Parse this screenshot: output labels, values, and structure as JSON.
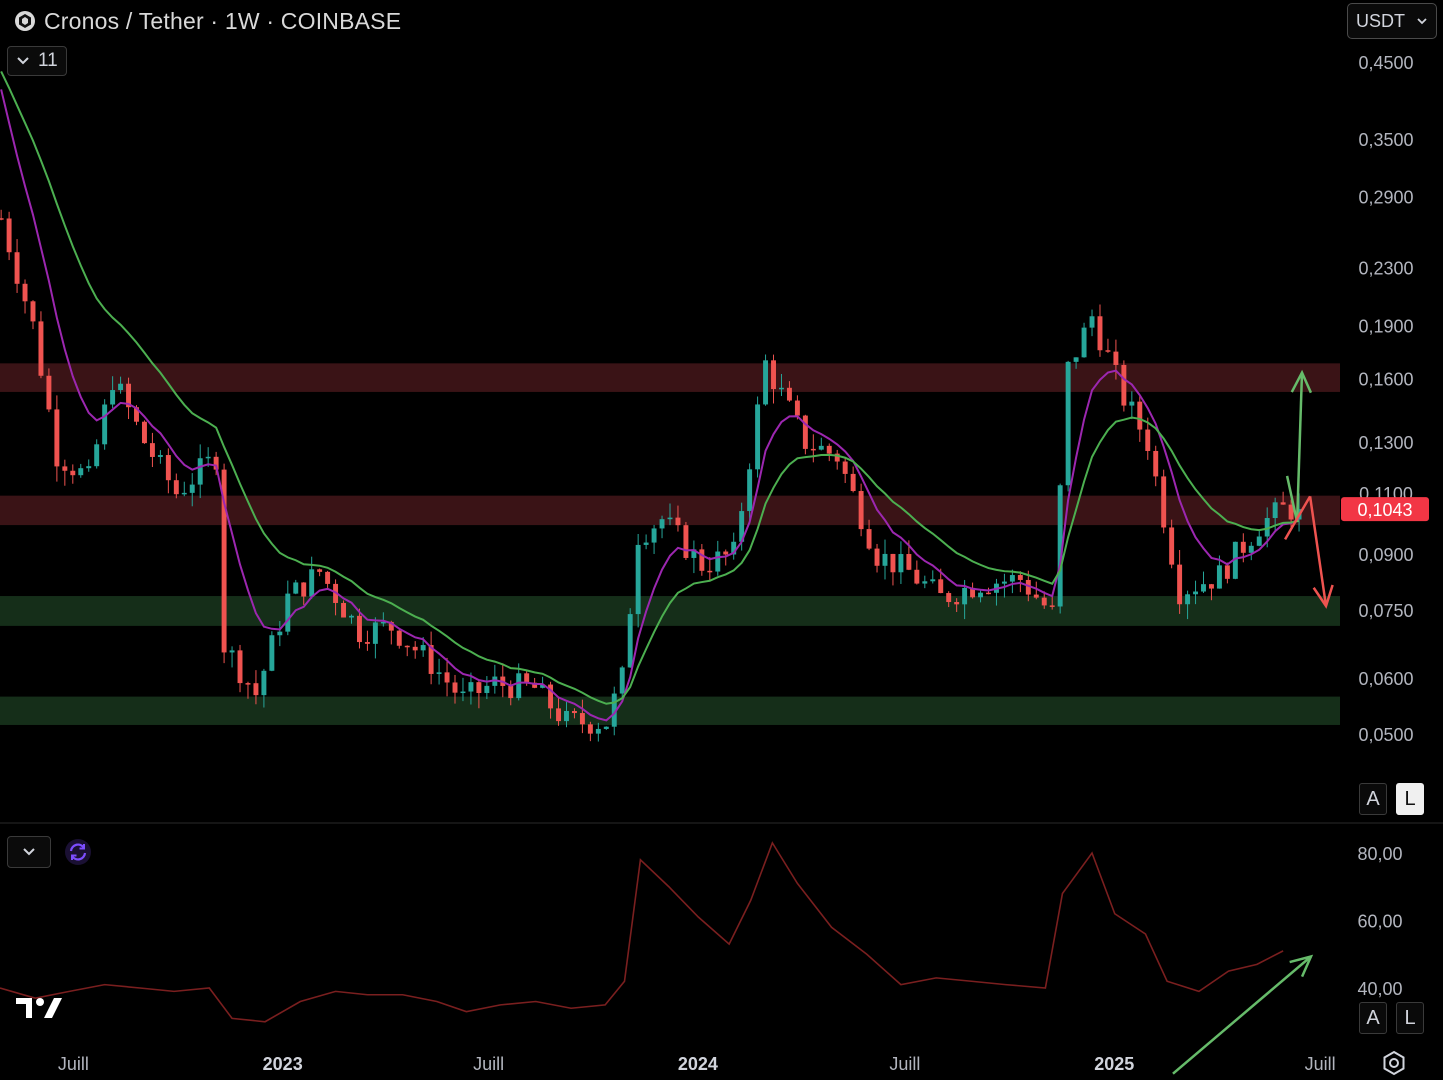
{
  "header": {
    "title": "Cronos / Tether · 1W · COINBASE",
    "indicator_count": "11",
    "currency": "USDT"
  },
  "controls": {
    "auto_label": "A",
    "log_label": "L"
  },
  "icons": [
    "cronos-coin-icon",
    "chevron-down-icon",
    "sync-icon",
    "tradingview-logo",
    "settings-icon"
  ],
  "colors": {
    "up": "#26a69a",
    "down": "#ef5350",
    "ema_fast": "#9c27b0",
    "ema_slow": "#4caf50",
    "resistance_zone": "#3d1417",
    "support_zone": "#16301a",
    "rsi": "#7a1f1f",
    "price_badge": "#f23645"
  },
  "chart_data": [
    {
      "type": "candlestick",
      "title": "Cronos / Tether · 1W · COINBASE",
      "scale": "log",
      "ylim": [
        0.046,
        0.48
      ],
      "y_ticks": [
        "0,4500",
        "0,3500",
        "0,2900",
        "0,2300",
        "0,1900",
        "0,1600",
        "0,1300",
        "0,1100",
        "0,0900",
        "0,0750",
        "0,0600",
        "0,0500"
      ],
      "y_tick_values": [
        0.45,
        0.35,
        0.29,
        0.23,
        0.19,
        0.16,
        0.13,
        0.11,
        0.09,
        0.075,
        0.06,
        0.05
      ],
      "x_ticks": [
        "Juill",
        "2023",
        "Juill",
        "2024",
        "Juill",
        "2025",
        "Juill"
      ],
      "x_tick_dates": [
        "2022-07-01",
        "2023-01-01",
        "2023-07-01",
        "2024-01-01",
        "2024-07-01",
        "2025-01-01",
        "2025-07-01"
      ],
      "x_range": [
        "2022-05-01",
        "2025-07-22"
      ],
      "last_price": "0,1043",
      "last_price_value": 0.1043,
      "zones": [
        {
          "kind": "resistance",
          "from": 0.153,
          "to": 0.168
        },
        {
          "kind": "resistance",
          "from": 0.099,
          "to": 0.109
        },
        {
          "kind": "support",
          "from": 0.0712,
          "to": 0.0785
        },
        {
          "kind": "support",
          "from": 0.0515,
          "to": 0.0565
        }
      ],
      "close_path": [
        [
          "2022-05-02",
          0.27
        ],
        [
          "2022-05-30",
          0.19
        ],
        [
          "2022-06-20",
          0.125
        ],
        [
          "2022-07-18",
          0.115
        ],
        [
          "2022-08-08",
          0.16
        ],
        [
          "2022-09-05",
          0.13
        ],
        [
          "2022-10-03",
          0.11
        ],
        [
          "2022-11-07",
          0.124
        ],
        [
          "2022-11-14",
          0.067
        ],
        [
          "2022-12-12",
          0.057
        ],
        [
          "2023-01-09",
          0.078
        ],
        [
          "2023-02-06",
          0.085
        ],
        [
          "2023-03-13",
          0.07
        ],
        [
          "2023-04-10",
          0.071
        ],
        [
          "2023-05-15",
          0.063
        ],
        [
          "2023-06-12",
          0.056
        ],
        [
          "2023-07-10",
          0.059
        ],
        [
          "2023-08-14",
          0.058
        ],
        [
          "2023-09-11",
          0.052
        ],
        [
          "2023-10-16",
          0.052
        ],
        [
          "2023-10-30",
          0.06
        ],
        [
          "2023-11-13",
          0.096
        ],
        [
          "2023-12-04",
          0.101
        ],
        [
          "2024-01-08",
          0.087
        ],
        [
          "2024-02-05",
          0.09
        ],
        [
          "2024-03-04",
          0.168
        ],
        [
          "2024-04-08",
          0.13
        ],
        [
          "2024-05-06",
          0.124
        ],
        [
          "2024-06-10",
          0.09
        ],
        [
          "2024-07-08",
          0.085
        ],
        [
          "2024-08-05",
          0.078
        ],
        [
          "2024-09-09",
          0.082
        ],
        [
          "2024-10-14",
          0.083
        ],
        [
          "2024-11-11",
          0.074
        ],
        [
          "2024-11-25",
          0.165
        ],
        [
          "2024-12-16",
          0.196
        ],
        [
          "2025-01-13",
          0.15
        ],
        [
          "2025-02-03",
          0.13
        ],
        [
          "2025-03-03",
          0.08
        ],
        [
          "2025-04-07",
          0.084
        ],
        [
          "2025-05-12",
          0.099
        ],
        [
          "2025-06-02",
          0.1043
        ]
      ],
      "scenario_arrows": [
        {
          "direction": "up",
          "from": [
            "2025-06-09",
            0.102
          ],
          "to": [
            "2025-07-22",
            0.163
          ]
        },
        {
          "direction": "down",
          "from": [
            "2025-06-09",
            0.097
          ],
          "to": [
            "2025-07-22",
            0.075
          ]
        }
      ],
      "series": [
        {
          "kind": "ema_fast"
        },
        {
          "kind": "ema_slow"
        }
      ]
    },
    {
      "type": "line",
      "ylim": [
        30,
        85
      ],
      "y_ticks": [
        "80,00",
        "60,00",
        "40,00"
      ],
      "y_tick_values": [
        80,
        60,
        40
      ],
      "values": [
        [
          "2022-05-01",
          40
        ],
        [
          "2022-06-01",
          37
        ],
        [
          "2022-07-01",
          39
        ],
        [
          "2022-08-01",
          41
        ],
        [
          "2022-09-01",
          40
        ],
        [
          "2022-10-01",
          39
        ],
        [
          "2022-11-01",
          40
        ],
        [
          "2022-11-21",
          31
        ],
        [
          "2022-12-20",
          30
        ],
        [
          "2023-01-20",
          36
        ],
        [
          "2023-02-20",
          39
        ],
        [
          "2023-03-20",
          38
        ],
        [
          "2023-04-20",
          38
        ],
        [
          "2023-05-20",
          36
        ],
        [
          "2023-06-15",
          33
        ],
        [
          "2023-07-15",
          35
        ],
        [
          "2023-08-15",
          36
        ],
        [
          "2023-09-15",
          34
        ],
        [
          "2023-10-15",
          35
        ],
        [
          "2023-11-01",
          42
        ],
        [
          "2023-11-15",
          78
        ],
        [
          "2023-12-10",
          70
        ],
        [
          "2024-01-05",
          61
        ],
        [
          "2024-02-01",
          53
        ],
        [
          "2024-02-20",
          66
        ],
        [
          "2024-03-10",
          83
        ],
        [
          "2024-04-01",
          71
        ],
        [
          "2024-05-01",
          58
        ],
        [
          "2024-06-01",
          50
        ],
        [
          "2024-07-01",
          41
        ],
        [
          "2024-08-01",
          43
        ],
        [
          "2024-09-01",
          42
        ],
        [
          "2024-10-01",
          41
        ],
        [
          "2024-11-05",
          40
        ],
        [
          "2024-11-20",
          68
        ],
        [
          "2024-12-16",
          80
        ],
        [
          "2025-01-05",
          62
        ],
        [
          "2025-02-01",
          56
        ],
        [
          "2025-02-20",
          42
        ],
        [
          "2025-03-20",
          39
        ],
        [
          "2025-04-15",
          45
        ],
        [
          "2025-05-10",
          47
        ],
        [
          "2025-06-02",
          51
        ]
      ],
      "trend_arrow": {
        "from": [
          "2025-03-20",
          31.5
        ],
        "to": [
          "2025-06-30",
          52
        ]
      }
    }
  ]
}
